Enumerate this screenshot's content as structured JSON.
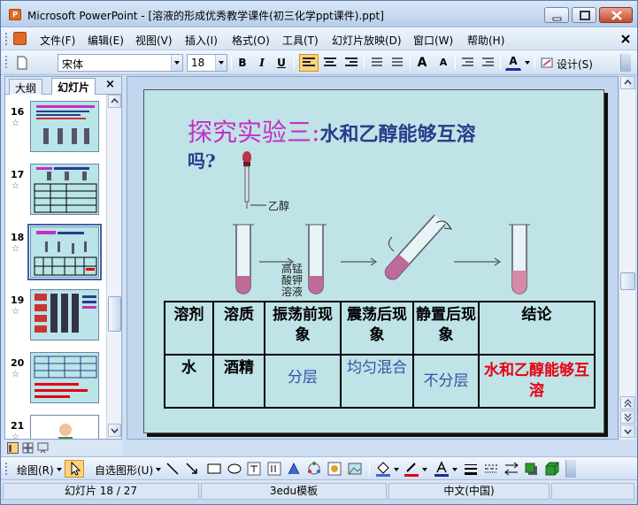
{
  "window": {
    "title": "Microsoft PowerPoint - [溶液的形成优秀教学课件(初三化学ppt课件).ppt]"
  },
  "menu": {
    "items": [
      {
        "label": "文件(F)"
      },
      {
        "label": "编辑(E)"
      },
      {
        "label": "视图(V)"
      },
      {
        "label": "插入(I)"
      },
      {
        "label": "格式(O)"
      },
      {
        "label": "工具(T)"
      },
      {
        "label": "幻灯片放映(D)"
      },
      {
        "label": "窗口(W)"
      },
      {
        "label": "帮助(H)"
      }
    ]
  },
  "format_toolbar": {
    "font_name": "宋体",
    "font_size": "18",
    "bold": "B",
    "italic": "I",
    "underline": "U",
    "grow_font": "A",
    "shrink_font": "A",
    "font_color": "A",
    "design_label": "设计(S)",
    "align_left_active": true
  },
  "left_pane": {
    "tabs": [
      {
        "label": "大纲",
        "selected": false
      },
      {
        "label": "幻灯片",
        "selected": true
      }
    ],
    "close": "×",
    "thumbnails": [
      {
        "number": "16",
        "selected": false
      },
      {
        "number": "17",
        "selected": false
      },
      {
        "number": "18",
        "selected": true
      },
      {
        "number": "19",
        "selected": false
      },
      {
        "number": "20",
        "selected": false
      },
      {
        "number": "21",
        "selected": false
      }
    ],
    "star": "☆"
  },
  "slide": {
    "title_part1": "探究实验三:",
    "title_part2": "水和乙醇能够互溶",
    "title_line2": "吗?",
    "label_ethanol": "乙醇",
    "label_kmno4": "高锰酸钾溶液",
    "table": {
      "headers": [
        "溶剂",
        "溶质",
        "振荡前现象",
        "震荡后现象",
        "静置后现象",
        "结论"
      ],
      "row": {
        "solvent": "水",
        "solute": "酒精",
        "before": "分层",
        "after": "均匀混合",
        "still": "不分层",
        "conclusion": "水和乙醇能够互溶"
      }
    },
    "colors": {
      "background": "#bfe3e6",
      "title_magenta": "#c430c4",
      "title_blue": "#2a3b8a",
      "conclusion_red": "#e60012",
      "liquid_purple": "#c06a9a"
    }
  },
  "drawing_toolbar": {
    "draw_label": "绘图(R)",
    "autoshapes_label": "自选图形(U)"
  },
  "status_bar": {
    "slide_info": "幻灯片 18 / 27",
    "template": "3edu模板",
    "language": "中文(中国)"
  }
}
